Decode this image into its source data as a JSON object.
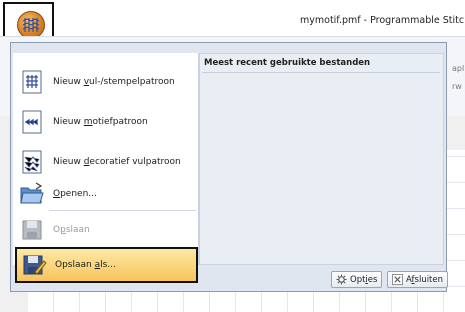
{
  "window": {
    "title": "mymotif.pmf - Programmable Stitch C"
  },
  "background": {
    "right_fragment_1": "apl",
    "right_fragment_2": "rw"
  },
  "menu": {
    "items": [
      {
        "label_pre": "Nieuw ",
        "label_key": "v",
        "label_post": "ul-/stempelpatroon",
        "icon": "fill-stamp-pattern-icon"
      },
      {
        "label_pre": "Nieuw ",
        "label_key": "m",
        "label_post": "otiefpatroon",
        "icon": "motif-pattern-icon"
      },
      {
        "label_pre": "Nieuw ",
        "label_key": "d",
        "label_post": "ecoratief vulpatroon",
        "icon": "decorative-fill-icon"
      },
      {
        "label_pre": "",
        "label_key": "O",
        "label_post": "penen...",
        "icon": "open-folder-icon"
      },
      {
        "label_pre": "O",
        "label_key": "p",
        "label_post": "slaan",
        "icon": "save-icon",
        "disabled": true
      },
      {
        "label_pre": "Opslaan ",
        "label_key": "a",
        "label_post": "ls...",
        "icon": "save-as-icon",
        "selected": true
      }
    ],
    "recent_header": "Meest recent gebruikte bestanden",
    "options_button": {
      "pre": "Opt",
      "key": "i",
      "post": "es"
    },
    "exit_button": {
      "pre": "A",
      "key": "f",
      "post": "sluiten"
    }
  },
  "colors": {
    "accent_selected": "#f8c45a",
    "menu_bg": "#dfe6ef"
  }
}
